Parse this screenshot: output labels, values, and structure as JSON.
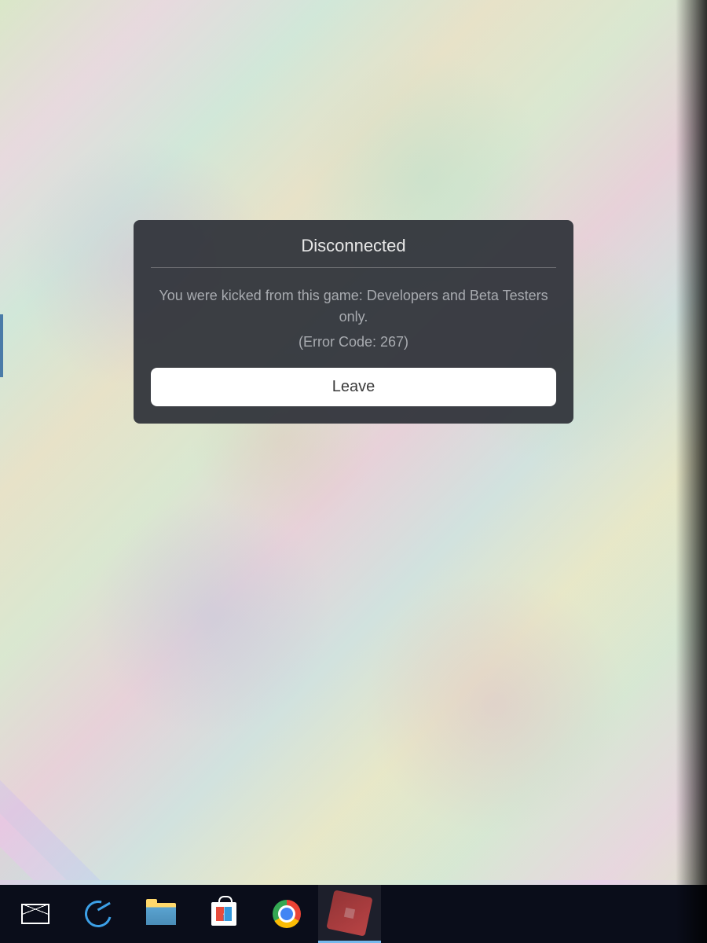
{
  "dialog": {
    "title": "Disconnected",
    "message": "You were kicked from this game: Developers and Beta Testers only.",
    "error_code": "(Error Code: 267)",
    "button_label": "Leave"
  },
  "taskbar": {
    "items": [
      {
        "name": "mail",
        "active": false
      },
      {
        "name": "edge",
        "active": false
      },
      {
        "name": "file-explorer",
        "active": false
      },
      {
        "name": "microsoft-store",
        "active": false
      },
      {
        "name": "chrome",
        "active": false
      },
      {
        "name": "roblox",
        "active": true
      }
    ]
  }
}
